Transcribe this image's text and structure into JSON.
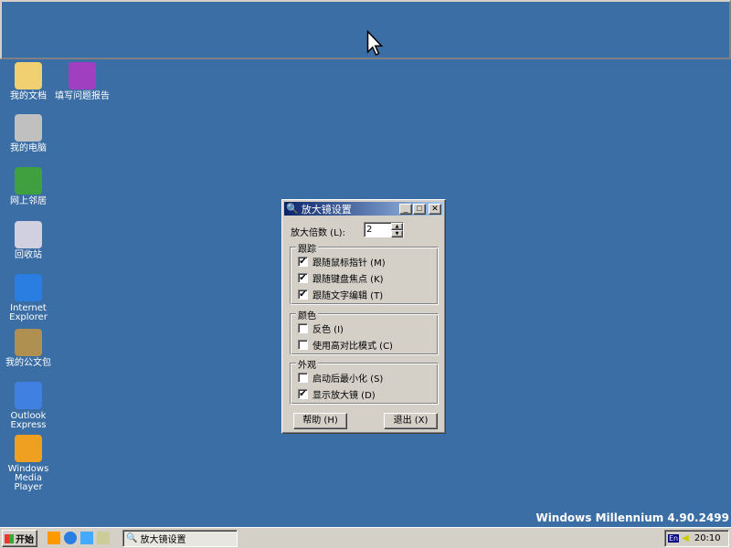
{
  "desktop": {
    "icons": [
      {
        "label": "我的文档",
        "icon": "my-documents-icon"
      },
      {
        "label": "填写问题报告",
        "icon": "problem-report-icon"
      },
      {
        "label": "我的电脑",
        "icon": "my-computer-icon"
      },
      {
        "label": "网上邻居",
        "icon": "network-neighborhood-icon"
      },
      {
        "label": "回收站",
        "icon": "recycle-bin-icon"
      },
      {
        "label": "Internet Explorer",
        "icon": "internet-explorer-icon"
      },
      {
        "label": "我的公文包",
        "icon": "briefcase-icon"
      },
      {
        "label": "Outlook Express",
        "icon": "outlook-express-icon"
      },
      {
        "label": "Windows Media Player",
        "icon": "media-player-icon"
      }
    ],
    "watermark": "Windows Millennium 4.90.2499",
    "background": "#3a6ea5"
  },
  "dialog": {
    "title": "放大镜设置",
    "zoom_label": "放大倍数 (L):",
    "zoom_value": "2",
    "tracking": {
      "title": "跟踪",
      "items": [
        {
          "label": "跟随鼠标指针 (M)",
          "checked": true
        },
        {
          "label": "跟随键盘焦点 (K)",
          "checked": true
        },
        {
          "label": "跟随文字编辑 (T)",
          "checked": true
        }
      ]
    },
    "colors": {
      "title": "颜色",
      "items": [
        {
          "label": "反色 (I)",
          "checked": false
        },
        {
          "label": "使用高对比模式 (C)",
          "checked": false
        }
      ]
    },
    "presentation": {
      "title": "外观",
      "items": [
        {
          "label": "启动后最小化 (S)",
          "checked": false
        },
        {
          "label": "显示放大镜 (D)",
          "checked": true
        }
      ]
    },
    "help": "帮助 (H)",
    "exit": "退出 (X)"
  },
  "taskbar": {
    "start": "开始",
    "task": "放大镜设置",
    "lang": "En",
    "time": "20:10"
  }
}
